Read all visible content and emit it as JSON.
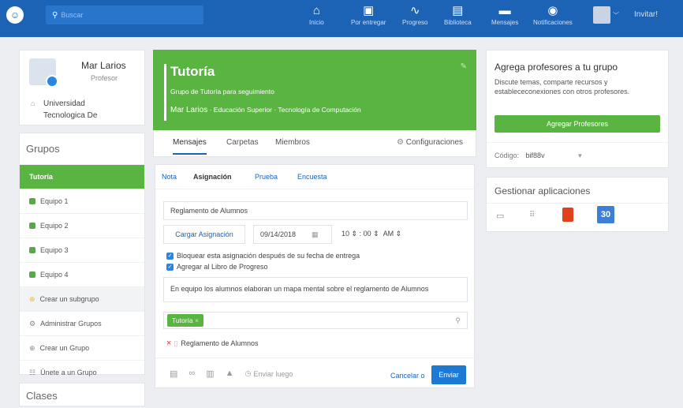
{
  "topbar": {
    "search_placeholder": "Buscar",
    "nav": [
      {
        "label": "Inicio",
        "icon": "home-icon"
      },
      {
        "label": "Por entregar",
        "icon": "inbox-icon"
      },
      {
        "label": "Progreso",
        "icon": "progress-icon"
      },
      {
        "label": "Biblioteca",
        "icon": "library-icon"
      },
      {
        "label": "Mensajes",
        "icon": "messages-icon"
      },
      {
        "label": "Notificaciones",
        "icon": "bell-icon"
      }
    ],
    "invite_label": "Invitar!"
  },
  "profile": {
    "name": "Mar Larios",
    "role": "Profesor",
    "school_line1": "Universidad",
    "school_line2": "Tecnologica De"
  },
  "sidebar": {
    "groups_title": "Grupos",
    "items": [
      {
        "label": "Tutoría"
      },
      {
        "label": "Equipo 1"
      },
      {
        "label": "Equipo 2"
      },
      {
        "label": "Equipo 3"
      },
      {
        "label": "Equipo 4"
      },
      {
        "label": "Crear un subgrupo"
      },
      {
        "label": "Administrar Grupos"
      },
      {
        "label": "Crear un Grupo"
      },
      {
        "label": "Únete a un Grupo"
      }
    ],
    "classes_title": "Clases"
  },
  "group": {
    "title": "Tutoría",
    "subtitle": "Grupo de Tutoría para seguimiento",
    "owner": "Mar Larios",
    "meta": " · Educación Superior · Tecnología de Computación"
  },
  "group_tabs": {
    "messages": "Mensajes",
    "folders": "Carpetas",
    "members": "Miembros",
    "settings": "Configuraciones"
  },
  "compose": {
    "tabs": [
      "Nota",
      "Asignación",
      "Prueba",
      "Encuesta"
    ],
    "title_value": "Reglamento de Alumnos",
    "load_button": "Cargar Asignación",
    "date": "09/14/2018",
    "hour": "10",
    "minute": "00",
    "ampm": "AM",
    "check1": "Bloquear esta asignación después de su fecha de entrega",
    "check2": "Agregar al Libro de Progreso",
    "description": "En equipo los alumnos elaboran un mapa mental sobre el reglamento de Alumnos",
    "recipient_tag": "Tutoría",
    "attachment": "Reglamento de Alumnos",
    "send_later": "Enviar luego",
    "cancel": "Cancelar o",
    "send": "Enviar"
  },
  "right": {
    "title": "Agrega profesores a tu grupo",
    "desc": "Discute temas, comparte recursos y establececonexiones con otros profesores.",
    "add_button": "Agregar Profesores",
    "code_label": "Código:",
    "code_value": "bif88v",
    "apps_title": "Gestionar aplicaciones",
    "calendar_day": "30"
  },
  "colors": {
    "brand": "#1c62b5",
    "green": "#5ab442",
    "blue_button": "#1c7ad4"
  }
}
